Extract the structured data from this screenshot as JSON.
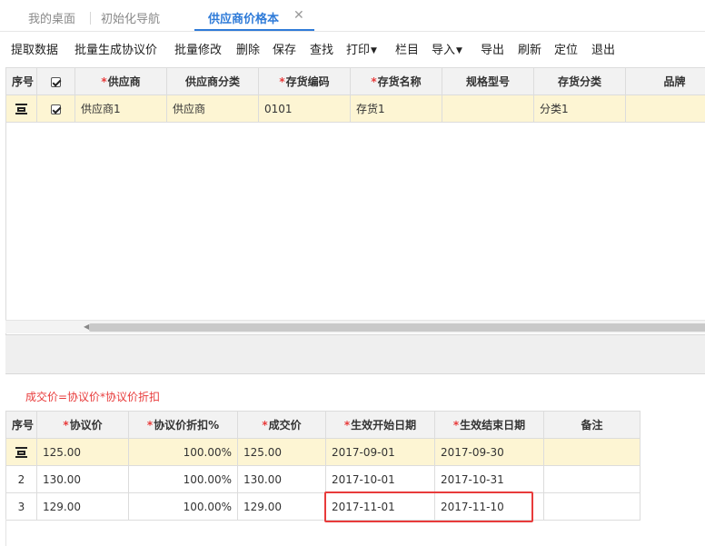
{
  "tabs": [
    {
      "label": "我的桌面",
      "active": false
    },
    {
      "label": "初始化导航",
      "active": false
    },
    {
      "label": "供应商价格本",
      "active": true
    }
  ],
  "toolbar": {
    "buttons": [
      "提取数据",
      "批量生成协议价",
      "批量修改",
      "删除",
      "保存",
      "查找",
      "打印",
      "栏目",
      "导入",
      "导出",
      "刷新",
      "定位",
      "退出"
    ]
  },
  "upper_grid": {
    "columns": [
      "序号",
      "",
      "供应商",
      "供应商分类",
      "存货编码",
      "存货名称",
      "规格型号",
      "存货分类",
      "品牌"
    ],
    "required": [
      false,
      false,
      true,
      false,
      true,
      true,
      false,
      false,
      false
    ],
    "rows": [
      {
        "supplier": "供应商1",
        "supplier_class": "供应商",
        "item_code": "0101",
        "item_name": "存货1",
        "spec": "",
        "item_class": "分类1",
        "brand": "",
        "checked": true
      }
    ]
  },
  "formula": "成交价=协议价*协议价折扣",
  "lower_grid": {
    "columns": [
      "序号",
      "协议价",
      "协议价折扣%",
      "成交价",
      "生效开始日期",
      "生效结束日期",
      "备注"
    ],
    "required": [
      false,
      true,
      true,
      true,
      true,
      true,
      false
    ],
    "rows": [
      {
        "seq": "",
        "agreed_price": "125.00",
        "discount": "100.00%",
        "deal_price": "125.00",
        "start": "2017-09-01",
        "end": "2017-09-30",
        "note": ""
      },
      {
        "seq": "2",
        "agreed_price": "130.00",
        "discount": "100.00%",
        "deal_price": "130.00",
        "start": "2017-10-01",
        "end": "2017-10-31",
        "note": ""
      },
      {
        "seq": "3",
        "agreed_price": "129.00",
        "discount": "100.00%",
        "deal_price": "129.00",
        "start": "2017-11-01",
        "end": "2017-11-10",
        "note": ""
      }
    ]
  },
  "colors": {
    "accent": "#2f7bd8",
    "required": "#e83b3b",
    "highlight_row": "#fdf5d3",
    "header_bg": "#f2f2f2"
  }
}
